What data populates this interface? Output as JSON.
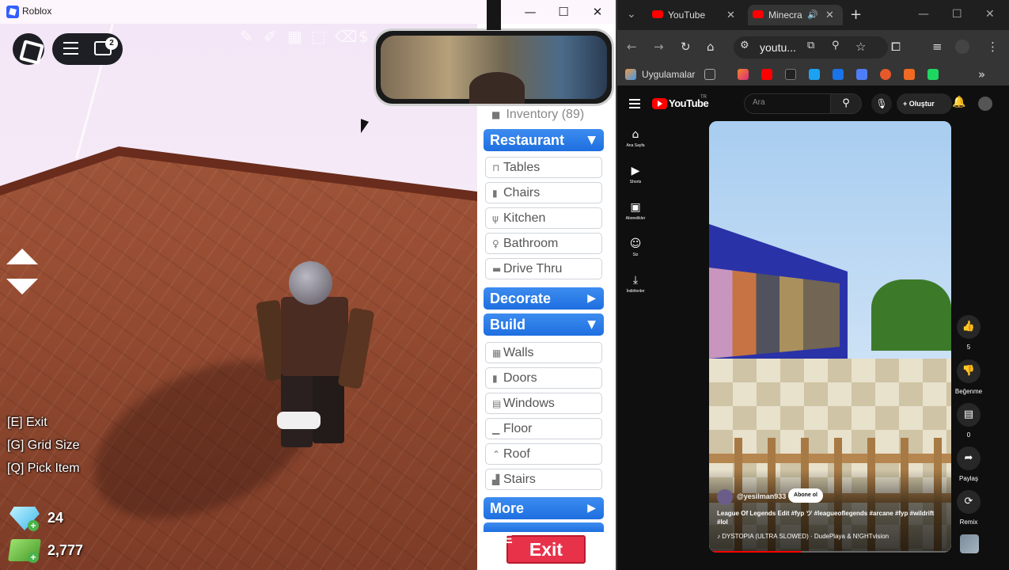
{
  "roblox": {
    "window_title": "Roblox",
    "chat_badge": "2",
    "hints": [
      "[E] Exit",
      "[G] Grid Size",
      "[Q] Pick Item"
    ],
    "gems": "24",
    "cash": "2,777",
    "inventory_label": "Inventory (89)",
    "categories": {
      "restaurant": "Restaurant",
      "decorate": "Decorate",
      "build": "Build",
      "more": "More"
    },
    "restaurant_items": [
      "Tables",
      "Chairs",
      "Kitchen",
      "Bathroom",
      "Drive Thru"
    ],
    "build_items": [
      "Walls",
      "Doors",
      "Windows",
      "Floor",
      "Roof",
      "Stairs"
    ],
    "exit_key": "E",
    "exit_label": "Exit"
  },
  "chrome": {
    "tabs": [
      {
        "label": "YouTube"
      },
      {
        "label": "Minecra"
      }
    ],
    "omnibox_text": "youtu...",
    "bookmarks_label": "Uygulamalar"
  },
  "youtube": {
    "logo_text": "YouTube",
    "region": "TR",
    "search_placeholder": "Ara",
    "create_label": "Oluştur",
    "sidebar": [
      {
        "label": "Ana Sayfa",
        "icon": "home-icon"
      },
      {
        "label": "Shorts",
        "icon": "shorts-icon"
      },
      {
        "label": "Abonelikler",
        "icon": "subscriptions-icon"
      },
      {
        "label": "Siz",
        "icon": "you-icon"
      },
      {
        "label": "İndirilenler",
        "icon": "download-icon"
      }
    ],
    "short": {
      "channel": "@yesilman933",
      "subscribe_label": "Abone ol",
      "title": "League Of Legends Edit #fyp ツ #leagueoflegends #arcane #fyp #wildrift #lol",
      "music": "DYSTOPIA (ULTRA SLOWED) · DudePlaya & N!GHTvision",
      "progress": 0.38
    },
    "actions": {
      "likes": "5",
      "dislike_label": "Beğenme",
      "comments": "0",
      "share_label": "Paylaş",
      "remix_label": "Remix"
    }
  }
}
